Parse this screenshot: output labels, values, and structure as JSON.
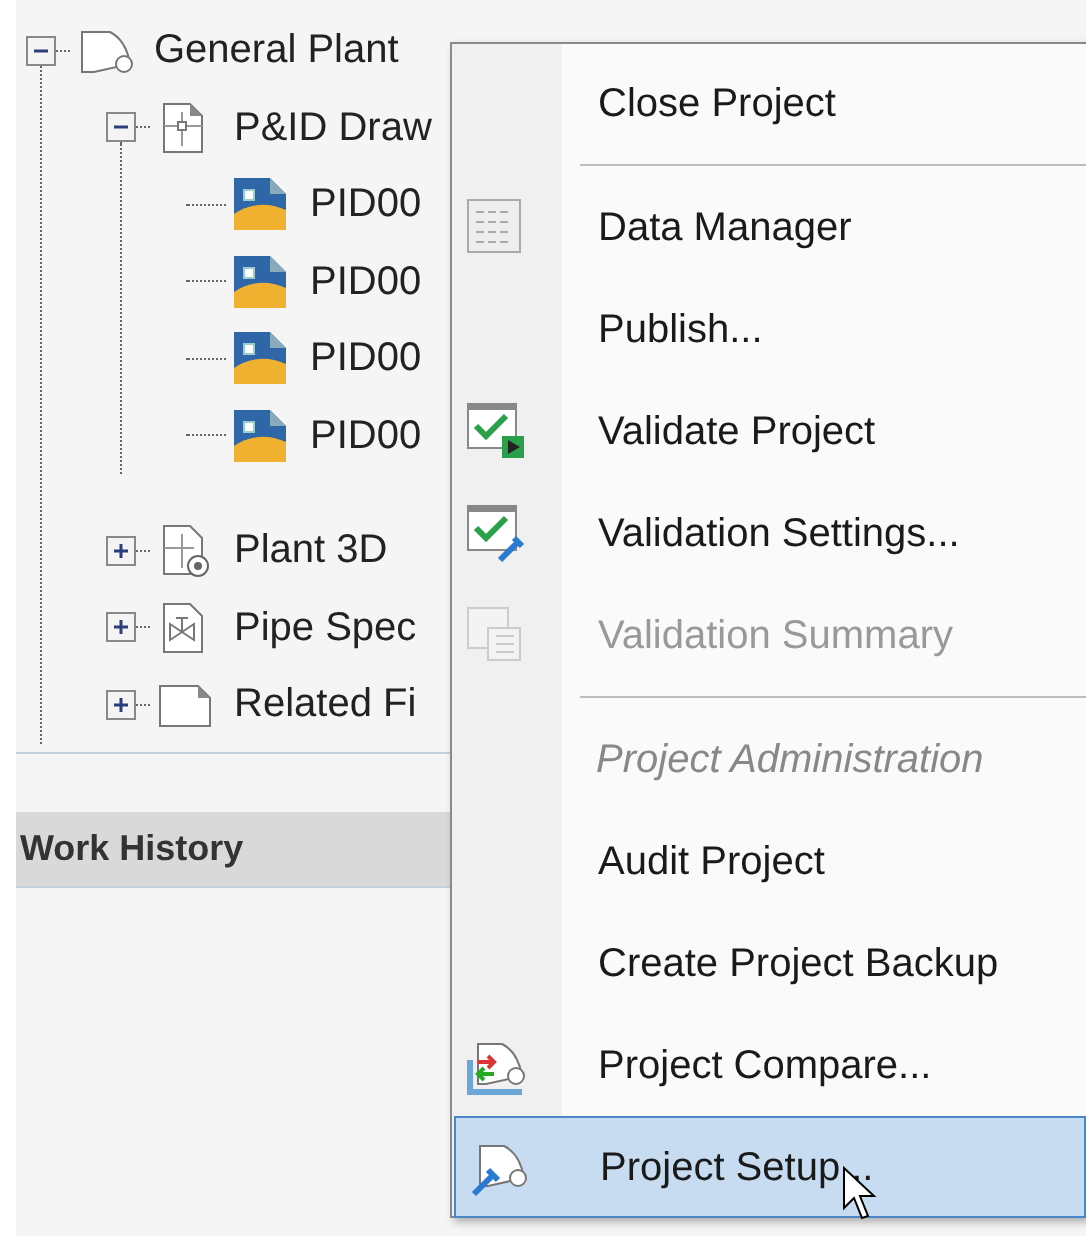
{
  "tree": [
    {
      "label": "General Plant",
      "kind": "project",
      "expanded": true,
      "children": [
        {
          "label": "P&ID Draw",
          "kind": "pid-folder",
          "expanded": true,
          "children": [
            {
              "label": "PID00",
              "kind": "drawing"
            },
            {
              "label": "PID00",
              "kind": "drawing"
            },
            {
              "label": "PID00",
              "kind": "drawing"
            },
            {
              "label": "PID00",
              "kind": "drawing"
            }
          ]
        },
        {
          "label": "Plant 3D",
          "kind": "plant-folder",
          "expanded": false
        },
        {
          "label": "Pipe Spec",
          "kind": "spec-folder",
          "expanded": false
        },
        {
          "label": "Related Fi",
          "kind": "files-folder",
          "expanded": false
        }
      ]
    }
  ],
  "work_history": {
    "title": "Work History"
  },
  "context_menu": [
    {
      "kind": "item",
      "label": "Close Project",
      "disabled": false,
      "selected": false
    },
    {
      "kind": "separator"
    },
    {
      "kind": "item",
      "label": "Data Manager",
      "disabled": false,
      "selected": false
    },
    {
      "kind": "item",
      "label": "Publish...",
      "disabled": false,
      "selected": false
    },
    {
      "kind": "item",
      "label": "Validate Project",
      "disabled": false,
      "selected": false
    },
    {
      "kind": "item",
      "label": "Validation Settings...",
      "disabled": false,
      "selected": false
    },
    {
      "kind": "item",
      "label": "Validation Summary",
      "disabled": true,
      "selected": false
    },
    {
      "kind": "separator"
    },
    {
      "kind": "header",
      "label": "Project Administration"
    },
    {
      "kind": "item",
      "label": "Audit Project",
      "disabled": false,
      "selected": false
    },
    {
      "kind": "item",
      "label": "Create Project Backup",
      "disabled": false,
      "selected": false
    },
    {
      "kind": "item",
      "label": "Project Compare...",
      "disabled": false,
      "selected": false
    },
    {
      "kind": "item",
      "label": "Project Setup...",
      "disabled": false,
      "selected": true
    }
  ]
}
